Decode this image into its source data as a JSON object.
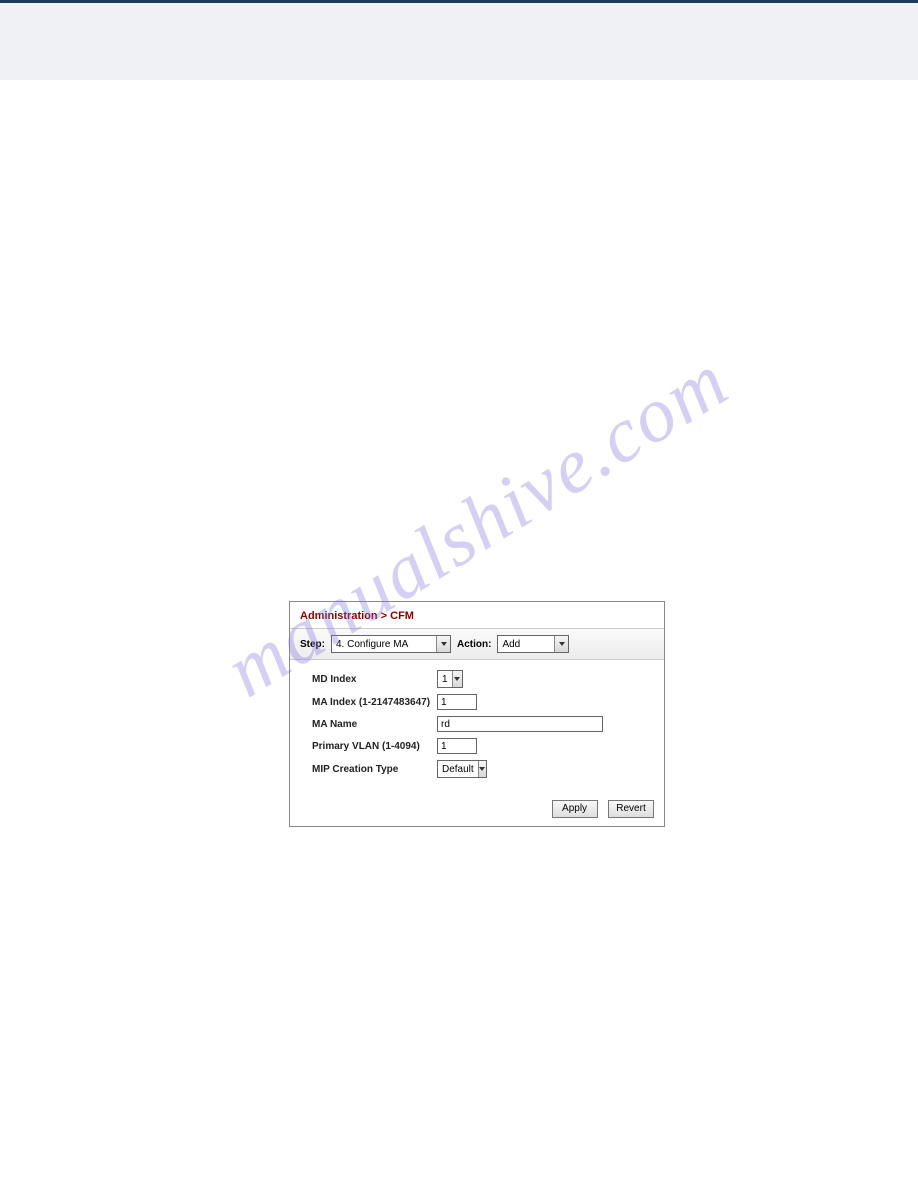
{
  "watermark": "manualshive.com",
  "panel": {
    "title": "Administration > CFM",
    "stepLabel": "Step:",
    "stepValue": "4. Configure MA",
    "actionLabel": "Action:",
    "actionValue": "Add",
    "fields": {
      "mdIndex": {
        "label": "MD Index",
        "value": "1"
      },
      "maIndex": {
        "label": "MA Index (1-2147483647)",
        "value": "1"
      },
      "maName": {
        "label": "MA Name",
        "value": "rd"
      },
      "primaryVlan": {
        "label": "Primary VLAN (1-4094)",
        "value": "1"
      },
      "mipCreation": {
        "label": "MIP Creation Type",
        "value": "Default"
      }
    },
    "buttons": {
      "apply": "Apply",
      "revert": "Revert"
    }
  }
}
